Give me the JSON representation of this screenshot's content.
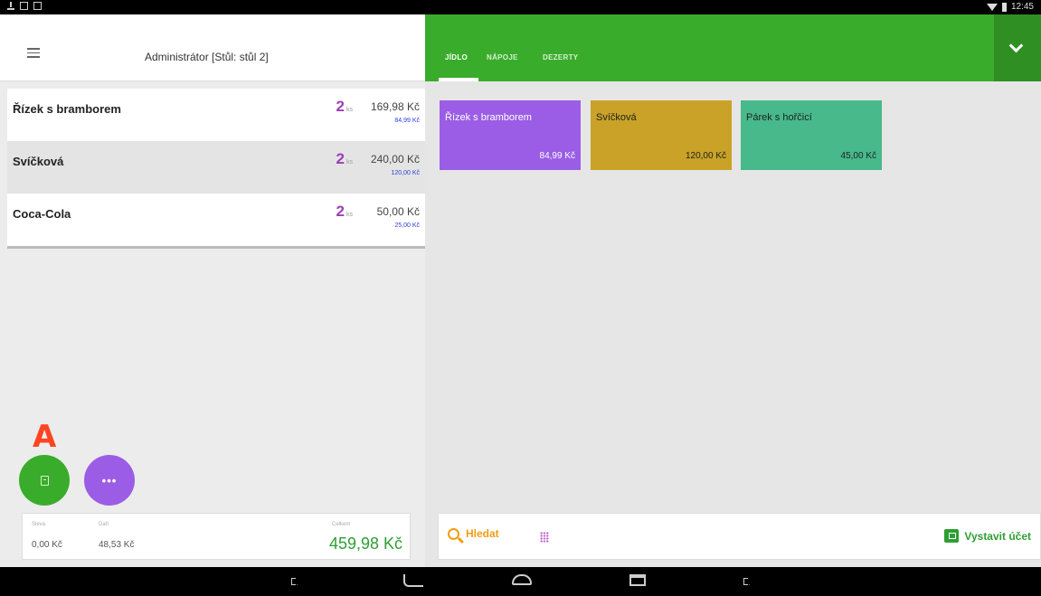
{
  "status": {
    "time": "12:45"
  },
  "left": {
    "title": "Administrátor [Stůl: stůl 2]",
    "items": [
      {
        "name": "Řízek s bramborem",
        "qty": "2",
        "unit": "ks",
        "total": "169,98 Kč",
        "unit_price": "84,99 Kč"
      },
      {
        "name": "Svíčková",
        "qty": "2",
        "unit": "ks",
        "total": "240,00 Kč",
        "unit_price": "120,00 Kč"
      },
      {
        "name": "Coca-Cola",
        "qty": "2",
        "unit": "ks",
        "total": "50,00 Kč",
        "unit_price": "25,00 Kč"
      }
    ],
    "marker": "A",
    "more_label": "•••",
    "summary": {
      "discount_label": "Sleva",
      "discount_value": "0,00 Kč",
      "tax_label": "Daň",
      "tax_value": "48,53 Kč",
      "total_label": "Celkem",
      "total_value": "459,98 Kč"
    }
  },
  "right": {
    "tabs": [
      {
        "label": "JÍDLO",
        "active": true
      },
      {
        "label": "NÁPOJE",
        "active": false
      },
      {
        "label": "DEZERTY",
        "active": false
      }
    ],
    "tiles": [
      {
        "name": "Řízek s bramborem",
        "price": "84,99 Kč",
        "color": "#9b5de5"
      },
      {
        "name": "Svíčková",
        "price": "120,00 Kč",
        "color": "#c9a227"
      },
      {
        "name": "Párek s hořčicí",
        "price": "45,00 Kč",
        "color": "#47b98a"
      }
    ],
    "bottom": {
      "search_label": "Hledat",
      "invoice_label": "Vystavit účet"
    }
  },
  "colors": {
    "accent": "#3aac2b",
    "accent_dark": "#2f8f23",
    "qty": "#9b3fb5",
    "unit_price": "#2d3fdb",
    "search": "#f39c12"
  }
}
